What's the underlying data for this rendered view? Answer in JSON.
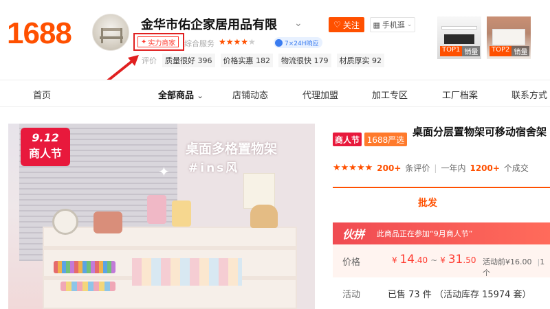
{
  "brand": {
    "logo": "1688",
    "color": "#ff5000"
  },
  "shop": {
    "name": "金华市佑企家居用品有限",
    "follow": "关注",
    "mobile": "手机逛",
    "badge": "实力商家",
    "service_label": "综合服务",
    "stars": "★★★★",
    "stars_dim": "★",
    "service_badge": "7×24H响应",
    "review_label": "评价",
    "review_tags": [
      {
        "label": "质量很好",
        "count": "396"
      },
      {
        "label": "价格实惠",
        "count": "182"
      },
      {
        "label": "物流很快",
        "count": "179"
      },
      {
        "label": "材质厚实",
        "count": "92"
      }
    ],
    "top_products": [
      {
        "rank": "TOP1",
        "label": "销量"
      },
      {
        "rank": "TOP2",
        "label": "销量"
      }
    ]
  },
  "nav": {
    "items": [
      "首页",
      "全部商品",
      "店铺动态",
      "代理加盟",
      "加工专区",
      "工厂档案",
      "联系方式"
    ]
  },
  "image": {
    "sale_date": "9.12",
    "sale_name": "商人节",
    "title": "桌面多格置物架",
    "subtitle": "#ins风"
  },
  "product": {
    "tag_merchant": "商人节",
    "tag_select": "1688严选",
    "title": "桌面分层置物架可移动宿舍架",
    "rating_stars": "★★★★★",
    "reviews": "200+",
    "reviews_label": "条评价",
    "year_label": "一年内",
    "deals": "1200+",
    "deals_label": "个成交",
    "tab": "批发",
    "promo_logo": "伙拼",
    "promo_text": "此商品正在参加“9月商人节”",
    "price_label": "价格",
    "currency": "¥",
    "price_low_int": "14",
    "price_low_dec": ".40",
    "price_tilde": "~",
    "price_high_int": "31",
    "price_high_dec": ".50",
    "pre_price": "活动前¥16.00",
    "pre_price_more": "1个",
    "activity_label": "活动",
    "activity_value": "已售 73 件 （活动库存 15974 套）"
  }
}
